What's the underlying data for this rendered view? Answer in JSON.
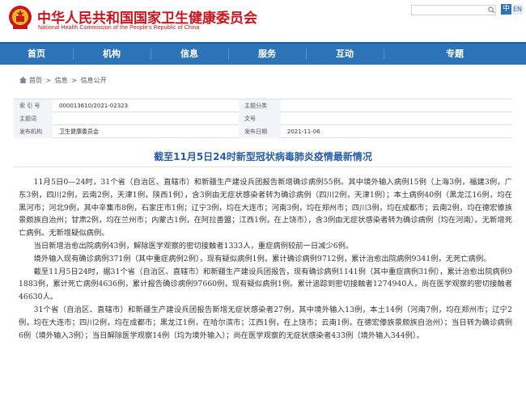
{
  "header": {
    "title": "中华人民共和国国家卫生健康委员会",
    "subtitle": "National Health Commission of the People's Republic of China",
    "lang_zh": "中",
    "lang_en": "EN",
    "emblem_icon": "national-emblem",
    "search_icon": "search-icon"
  },
  "colors": {
    "brand_red": "#c8161d",
    "nav_blue": "#2d73b8",
    "title_blue": "#2a5ea8"
  },
  "nav": {
    "items": [
      {
        "label": "首页"
      },
      {
        "label": "机构"
      },
      {
        "label": "信息"
      },
      {
        "label": "服务"
      },
      {
        "label": "互动"
      },
      {
        "label": "专题"
      }
    ]
  },
  "breadcrumb": {
    "home": "首页",
    "sep1": ">",
    "level1": "信息",
    "sep2": ">",
    "level2": "信息公开"
  },
  "meta": {
    "index_key": "索 引 号",
    "index_val": "000013610/2021-02323",
    "category_key": "主题分类",
    "category_val": "",
    "org_key": "发布机构",
    "org_val": "卫生健康委员会",
    "topic_key": "主题词",
    "topic_val": "",
    "docno_key": "文号",
    "docno_val": "",
    "date_key": "发布日期",
    "date_val": "2021-11-06"
  },
  "article": {
    "title": "截至11月5日24时新型冠状病毒肺炎疫情最新情况",
    "paragraphs": [
      "11月5日0—24时，31个省（自治区、直辖市）和新疆生产建设兵团报告新增确诊病例55例。其中境外输入病例15例（上海3例，福建3例，广东3例，四川2例，云南2例，天津1例，陕西1例），含3例由无症状感染者转为确诊病例（四川2例，天津1例）；本土病例40例（黑龙江16例，均在黑河市；河北9例，其中辛集市8例，石家庄市1例；辽宁3例，均在大连市；河南3例，均在郑州市；四川3例，均在成都市；云南2例，均在德宏傣族景颇族自治州；甘肃2例，均在兰州市；内蒙古1例，在阿拉善盟；江西1例，在上饶市），含3例由无症状感染者转为确诊病例（均在河南）。无新增死亡病例。无新增疑似病例。",
      "当日新增治愈出院病例43例，解除医学观察的密切接触者1333人，重症病例较前一日减少6例。",
      "境外输入现有确诊病例371例（其中重症病例2例），现有疑似病例1例。累计确诊病例9712例，累计治愈出院病例9341例，无死亡病例。",
      "截至11月5日24时，据31个省（自治区、直辖市）和新疆生产建设兵团报告，现有确诊病例1141例（其中重症病例31例），累计治愈出院病例91883例，累计死亡病例4636例，累计报告确诊病例97660例，现有疑似病例1例。累计追踪到密切接触者1274940人，尚在医学观察的密切接触者46630人。",
      "31个省（自治区、直辖市）和新疆生产建设兵团报告新增无症状感染者27例，其中境外输入13例，本土14例（河南7例，均在郑州市；辽宁2例，均在大连市；四川2例，均在成都市；黑龙江1例，在哈尔滨市；江西1例，在上饶市；云南1例，在德宏傣族景颇族自治州）；当日转为确诊病例6例（境外输入3例）；当日解除医学观察14例（均为境外输入）；尚在医学观察的无症状感染者433例（境外输入344例）。"
    ]
  }
}
